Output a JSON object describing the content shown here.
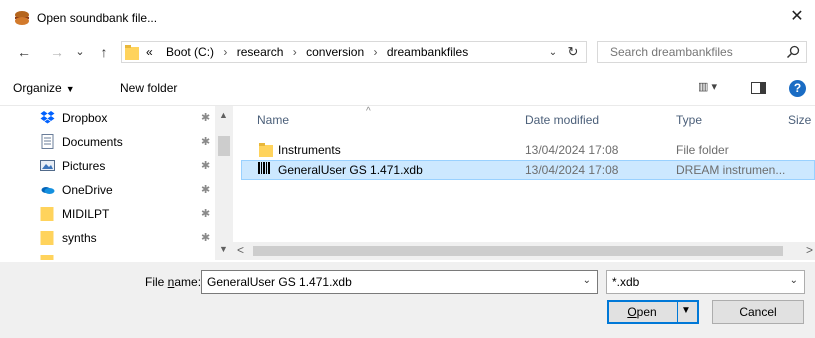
{
  "window": {
    "title": "Open soundbank file...",
    "icon": "soundbank-app-icon",
    "close_glyph": "✕"
  },
  "nav": {
    "back_glyph": "←",
    "forward_glyph": "→",
    "recent_glyph": "⌄",
    "up_glyph": "↑"
  },
  "address": {
    "overflow": "«",
    "crumbs": [
      "Boot (C:)",
      "research",
      "conversion",
      "dreambankfiles"
    ],
    "separator": "›",
    "dropdown_glyph": "⌄",
    "refresh_glyph": "↻"
  },
  "search": {
    "placeholder": "Search dreambankfiles"
  },
  "toolbar": {
    "organize": "Organize",
    "organize_arrow": "▼",
    "new_folder": "New folder",
    "views_glyph": "▥ ▾",
    "help": "?"
  },
  "sidebar": {
    "pin_glyph": "📌",
    "items": [
      {
        "label": "Dropbox",
        "icon": "dropbox-icon",
        "pinned": true
      },
      {
        "label": "Documents",
        "icon": "documents-icon",
        "pinned": true
      },
      {
        "label": "Pictures",
        "icon": "pictures-icon",
        "pinned": true
      },
      {
        "label": "OneDrive",
        "icon": "onedrive-icon",
        "pinned": true
      },
      {
        "label": "MIDILPT",
        "icon": "folder-icon",
        "pinned": true
      },
      {
        "label": "synths",
        "icon": "folder-icon",
        "pinned": true
      }
    ],
    "scroll_up": "▲",
    "scroll_down": "▼"
  },
  "files": {
    "columns": [
      "Name",
      "Date modified",
      "Type",
      "Size"
    ],
    "sort_caret": "^",
    "rows": [
      {
        "name": "Instruments",
        "date": "13/04/2024 17:08",
        "type": "File folder",
        "icon": "folder-icon",
        "selected": false
      },
      {
        "name": "GeneralUser GS 1.471.xdb",
        "date": "13/04/2024 17:08",
        "type": "DREAM instrumen...",
        "icon": "xdb-file-icon",
        "selected": true
      }
    ],
    "scroll_left": "<",
    "scroll_right": ">"
  },
  "bottom": {
    "filename_label_pre": "File ",
    "filename_label_u": "n",
    "filename_label_post": "ame:",
    "filename_value": "GeneralUser GS 1.471.xdb",
    "filter_value": "*.xdb",
    "dropdown_glyph": "⌄",
    "open_u": "O",
    "open_rest": "pen",
    "open_dd": "▼",
    "cancel": "Cancel"
  }
}
